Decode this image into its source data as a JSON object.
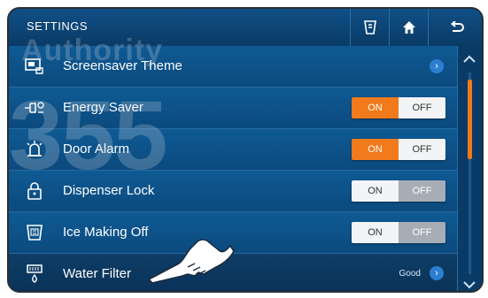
{
  "header": {
    "title": "SETTINGS",
    "buttons": [
      {
        "name": "manual-icon"
      },
      {
        "name": "home-icon"
      },
      {
        "name": "back-icon"
      }
    ]
  },
  "rows": [
    {
      "label": "Screensaver Theme",
      "control": "chevron"
    },
    {
      "label": "Energy Saver",
      "control": "toggle",
      "on": "ON",
      "off": "OFF",
      "value": "ON"
    },
    {
      "label": "Door Alarm",
      "control": "toggle",
      "on": "ON",
      "off": "OFF",
      "value": "ON"
    },
    {
      "label": "Dispenser Lock",
      "control": "toggle",
      "on": "ON",
      "off": "OFF",
      "value": "OFF"
    },
    {
      "label": "Ice Making Off",
      "control": "toggle",
      "on": "ON",
      "off": "OFF",
      "value": "OFF"
    },
    {
      "label": "Water Filter",
      "control": "status",
      "status": "Good"
    }
  ],
  "watermark": {
    "line1": "Authority",
    "line2": "355"
  },
  "colors": {
    "accent": "#f07a1c",
    "panel": "#0b4a7d",
    "header": "#0f4f86"
  }
}
